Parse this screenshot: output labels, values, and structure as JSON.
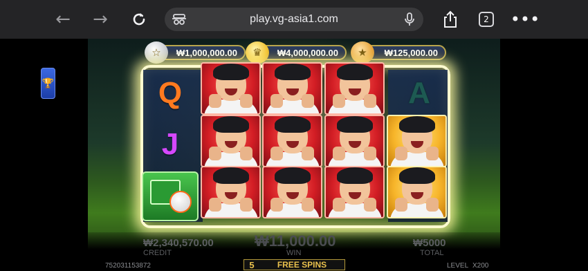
{
  "browser": {
    "url": "play.vg-asia1.com",
    "tab_count": "2",
    "icons": [
      "back-arrow-icon",
      "forward-arrow-icon",
      "reload-icon",
      "incognito-icon",
      "microphone-icon",
      "share-icon",
      "more-icon"
    ]
  },
  "side_badge": {
    "icon": "trophy-icon"
  },
  "jackpots": [
    {
      "tier": "silver",
      "value": "₩1,000,000.00",
      "color": "#c9ccd2"
    },
    {
      "tier": "gold-crown",
      "value": "₩4,000,000.00",
      "color": "#f2c230"
    },
    {
      "tier": "bronze",
      "value": "₩125,000.00",
      "color": "#e6a33a"
    }
  ],
  "reels": {
    "col1": [
      "Q",
      "J",
      "scatter"
    ],
    "col2": [
      "player",
      "player",
      "player"
    ],
    "col3": [
      "player",
      "player",
      "player"
    ],
    "col4": [
      "player",
      "player",
      "player"
    ],
    "col5": [
      "A",
      "player-gold",
      "player-gold"
    ]
  },
  "letter_colors": {
    "Q": "#ff7a1f",
    "J": "#d548ff",
    "A": "#1d5a52"
  },
  "bottom": {
    "credit_value": "₩2,340,570.00",
    "credit_label": "CREDIT",
    "win_value": "₩11,000.00",
    "win_label": "WIN",
    "total_value": "₩5000",
    "total_label": "TOTAL",
    "round_id": "752031153872",
    "free_spins_count": "5",
    "free_spins_label": "FREE SPINS",
    "level_label": "LEVEL",
    "level_value": "X200"
  }
}
